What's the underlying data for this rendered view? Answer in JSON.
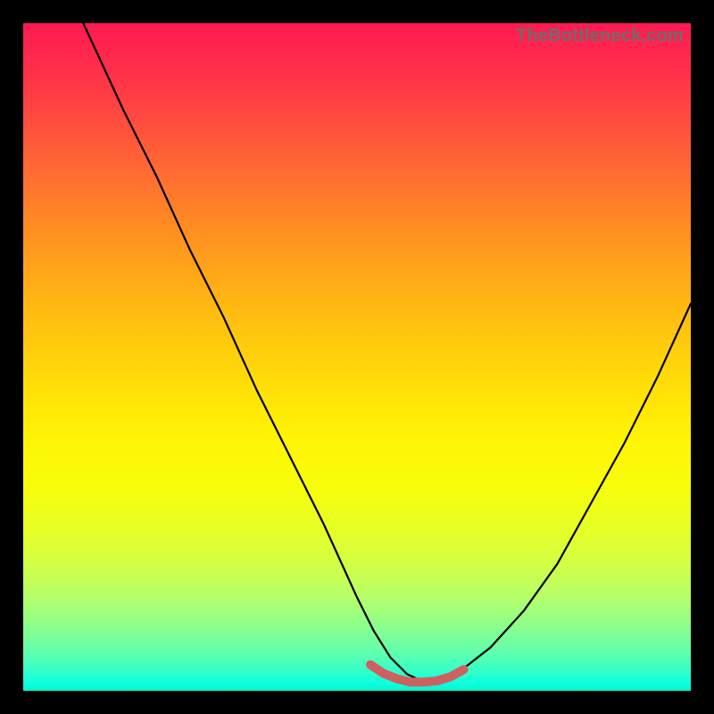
{
  "watermark": "TheBottleneck.com",
  "chart_data": {
    "type": "line",
    "title": "",
    "xlabel": "",
    "ylabel": "",
    "xlim": [
      0,
      100
    ],
    "ylim": [
      0,
      100
    ],
    "grid": false,
    "series": [
      {
        "name": "curve",
        "color": "#000000",
        "x": [
          9,
          15,
          20,
          25,
          30,
          35,
          40,
          45,
          50,
          52.5,
          55,
          57.5,
          60,
          62.5,
          65,
          70,
          75,
          80,
          85,
          90,
          95,
          100
        ],
        "y": [
          100,
          87,
          77,
          66,
          56,
          45,
          35,
          25,
          14,
          9,
          5,
          2.5,
          1.3,
          1.3,
          2.6,
          6.5,
          12,
          19,
          28,
          37,
          47,
          58
        ]
      },
      {
        "name": "bottom-highlight",
        "color": "#cf6060",
        "x": [
          52,
          54,
          56,
          58,
          60,
          62,
          64,
          66
        ],
        "y": [
          3.9,
          2.6,
          1.8,
          1.3,
          1.3,
          1.5,
          2.1,
          3.2
        ]
      }
    ],
    "colormap": {
      "top": "#ff1a52",
      "middle": "#ffe607",
      "bottom": "#02f6c6"
    }
  }
}
